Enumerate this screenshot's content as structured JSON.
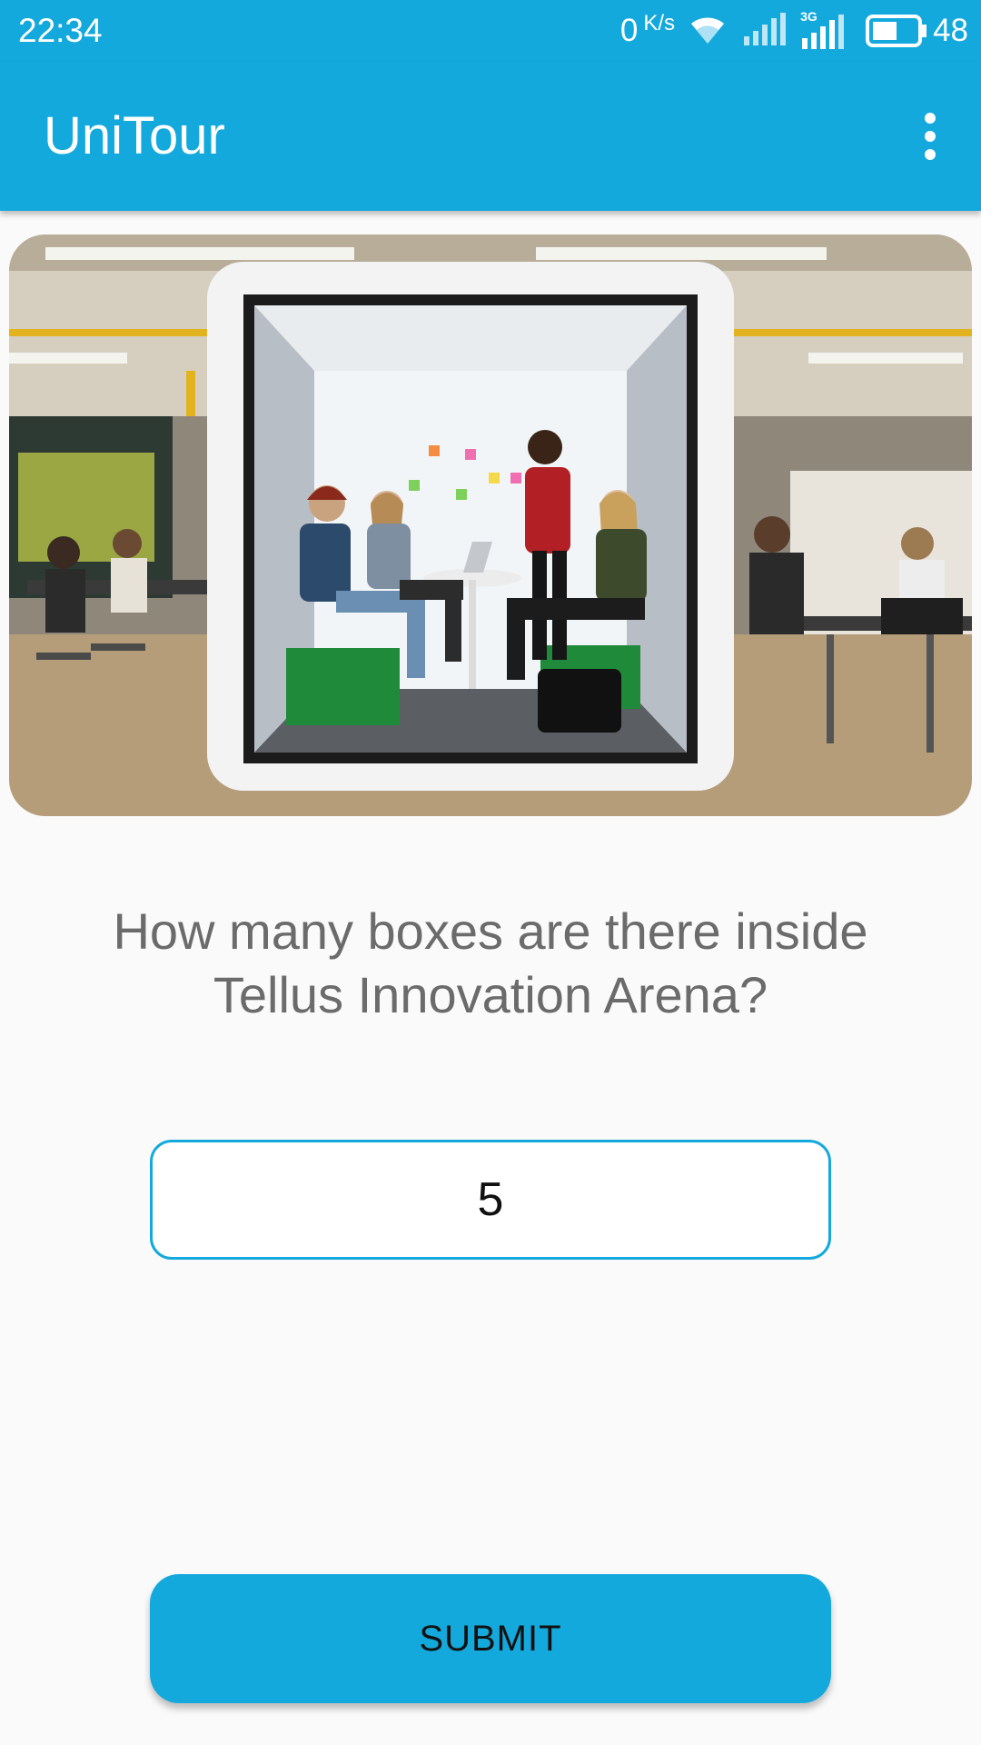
{
  "status_bar": {
    "time": "22:34",
    "net_speed_value": "0",
    "net_speed_unit": "K/s",
    "network_type": "3G",
    "battery_percent": "48",
    "icons": [
      "wifi-icon",
      "signal-icon",
      "battery-icon"
    ]
  },
  "app_bar": {
    "title": "UniTour",
    "menu_icon": "more-vert-icon"
  },
  "quiz": {
    "question": "How many boxes are there inside Tellus Innovation Arena?",
    "answer_value": "5",
    "submit_label": "SUBMIT"
  },
  "colors": {
    "accent": "#14a9dc",
    "background": "#fafafa",
    "question_text": "#6b6b6b"
  }
}
